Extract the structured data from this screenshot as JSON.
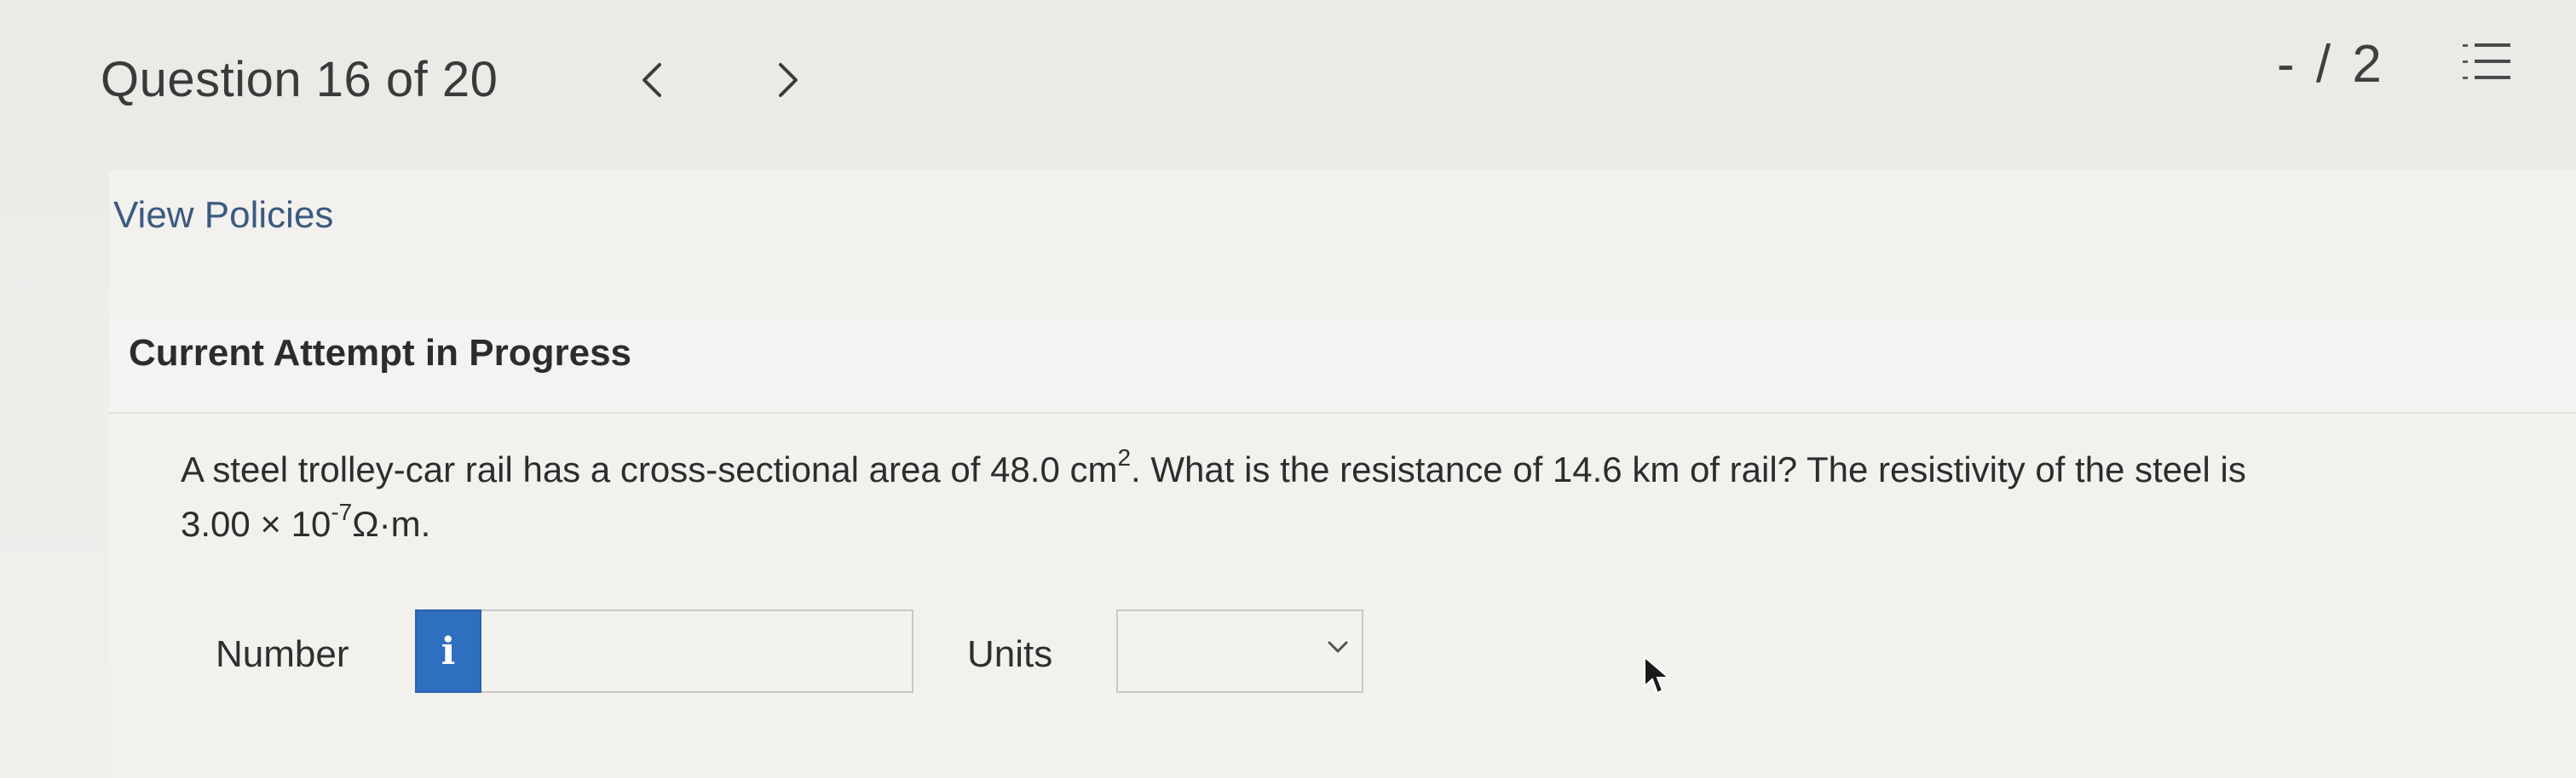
{
  "header": {
    "question_counter": "Question 16 of 20",
    "score": "- / 2"
  },
  "links": {
    "view_policies": "View Policies"
  },
  "attempt": {
    "status": "Current Attempt in Progress"
  },
  "question": {
    "line1_part1": "A steel trolley-car rail has a cross-sectional area of 48.0 cm",
    "area_exponent": "2",
    "line1_part2": ". What is the resistance of 14.6 km of rail? The resistivity of the steel is",
    "line2_part1": "3.00 × 10",
    "resistivity_exponent": "-7",
    "line2_part2": "Ω·m."
  },
  "answer": {
    "number_label": "Number",
    "info_icon": "i",
    "number_value": "",
    "units_label": "Units",
    "units_selected": ""
  },
  "icons": {
    "prev": "chevron-left-icon",
    "next": "chevron-right-icon",
    "question_list": "numbered-list-icon",
    "units_dropdown": "chevron-down-icon",
    "mouse": "cursor-arrow-icon"
  },
  "colors": {
    "link": "#3b5a80",
    "info_button": "#2f6fbf"
  }
}
